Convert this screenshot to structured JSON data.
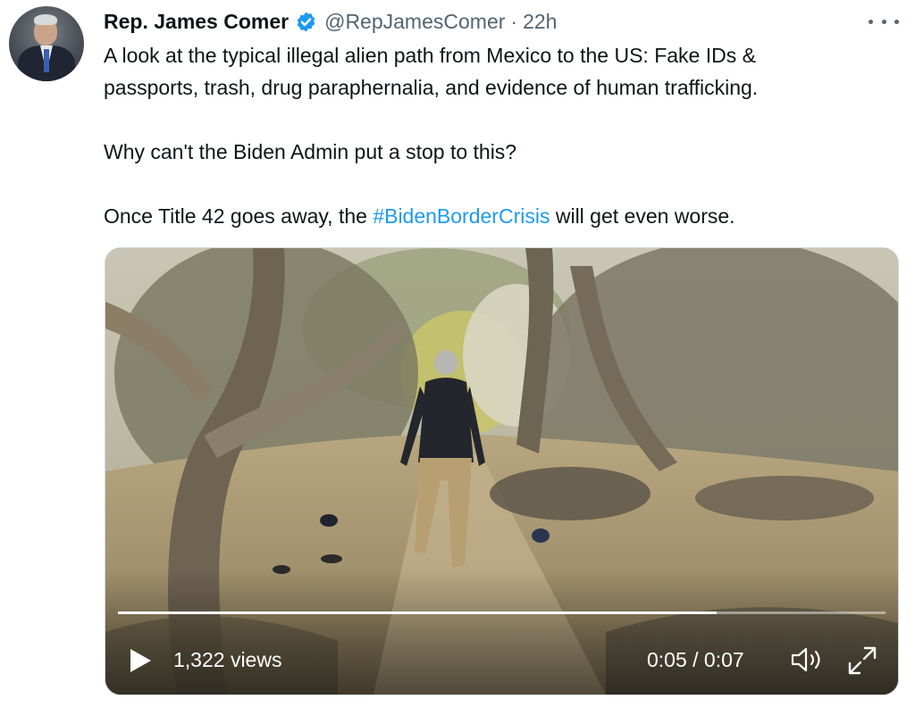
{
  "author": {
    "name": "Rep. James Comer",
    "handle": "@RepJamesComer",
    "separator": "·",
    "time": "22h"
  },
  "tweet": {
    "line1": "A look at the typical illegal alien path from Mexico to the US: Fake IDs &",
    "line2": "passports, trash, drug paraphernalia, and evidence of human trafficking.",
    "line3": "Why can't the Biden Admin put a stop to this?",
    "line4_before": "Once Title 42 goes away, the ",
    "hashtag": "#BidenBorderCrisis",
    "line4_after": " will get even worse."
  },
  "video": {
    "views": "1,322 views",
    "timecode": "0:05 / 0:07",
    "progress_fraction": 0.78
  },
  "icons": {
    "verified": "verified-badge-icon",
    "more": "more-options-icon",
    "play": "play-icon",
    "volume": "volume-icon",
    "fullscreen": "fullscreen-icon"
  },
  "colors": {
    "accent": "#1d9bf0",
    "secondary_text": "#536471",
    "primary_text": "#0f1419"
  }
}
